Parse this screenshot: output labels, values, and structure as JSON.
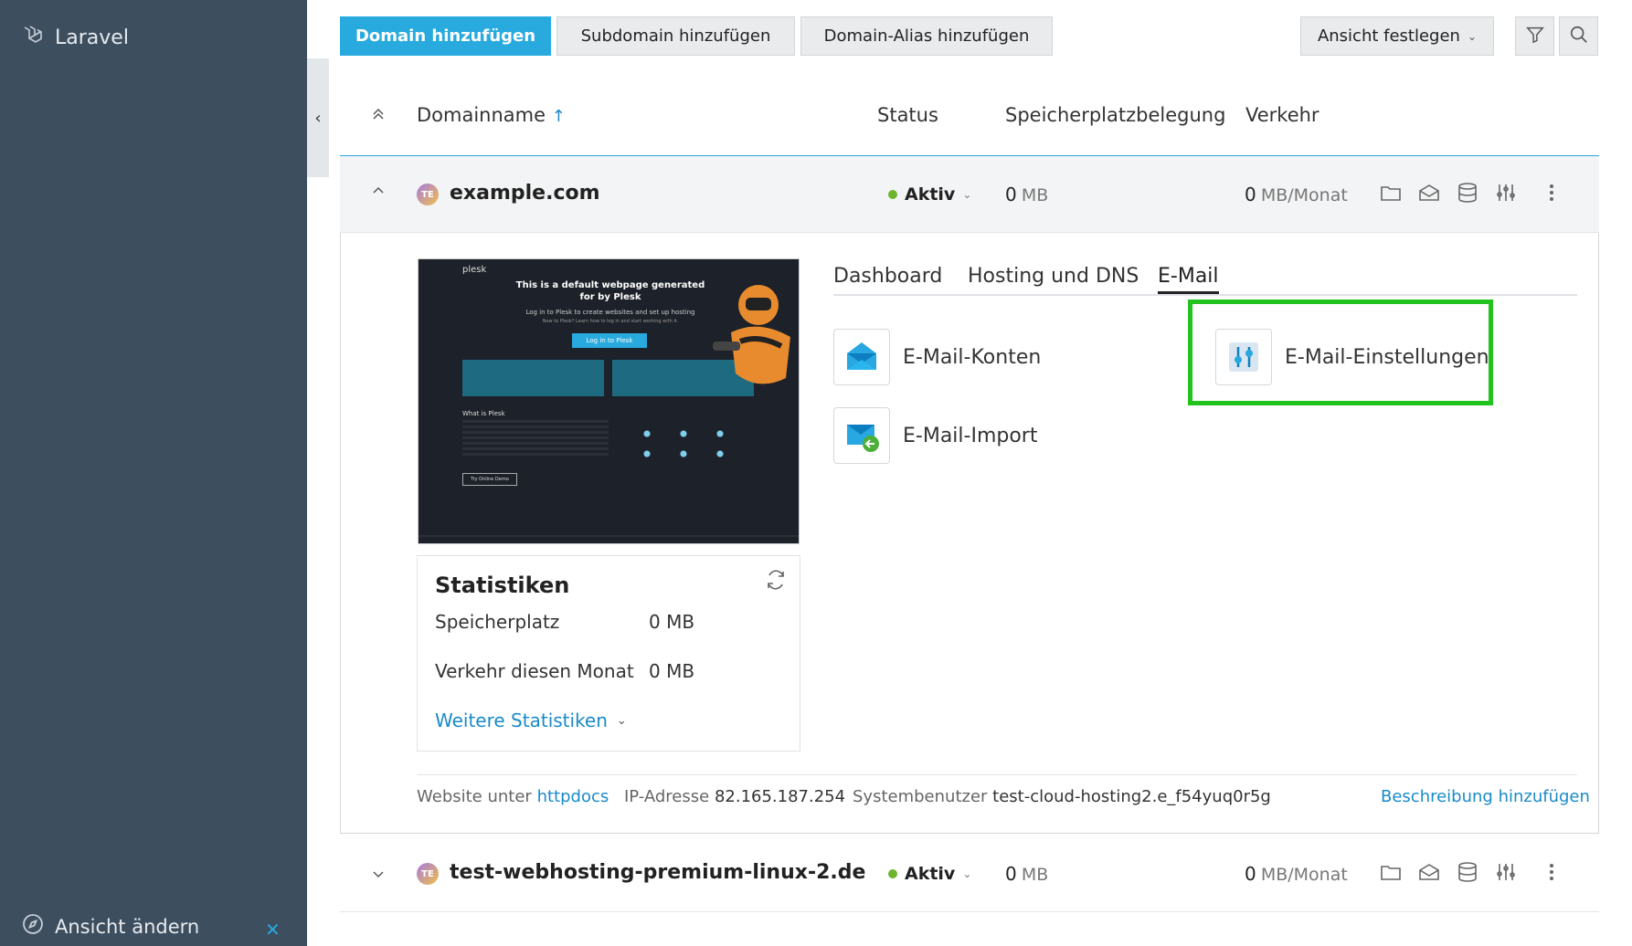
{
  "sidebar": {
    "brand": "Laravel",
    "bottom_label": "Ansicht ändern"
  },
  "toolbar": {
    "add_domain": "Domain hinzufügen",
    "add_subdomain": "Subdomain hinzufügen",
    "add_alias": "Domain-Alias hinzufügen",
    "view": "Ansicht festlegen"
  },
  "table": {
    "col_domain": "Domainname",
    "col_status": "Status",
    "col_storage": "Speicherplatzbelegung",
    "col_traffic": "Verkehr"
  },
  "domains": [
    {
      "avatar": "TE",
      "name": "example.com",
      "status": "Aktiv",
      "storage_value": "0",
      "storage_unit": "MB",
      "traffic_value": "0",
      "traffic_unit": "MB/Monat"
    },
    {
      "avatar": "TE",
      "name": "test-webhosting-premium-linux-2.de",
      "status": "Aktiv",
      "storage_value": "0",
      "storage_unit": "MB",
      "traffic_value": "0",
      "traffic_unit": "MB/Monat"
    }
  ],
  "preview": {
    "brand": "plesk",
    "heading": "This is a default webpage generated for by Plesk",
    "sub": "Log in to Plesk to create websites and set up hosting",
    "sub2": "New to Plesk? Learn how to log in and start working with it.",
    "button": "Log in to Plesk",
    "what_is": "What is Plesk",
    "demo_button": "Try Online Demo"
  },
  "stats": {
    "title": "Statistiken",
    "storage_label": "Speicherplatz",
    "storage_value": "0 MB",
    "traffic_label": "Verkehr diesen Monat",
    "traffic_value": "0 MB",
    "more_link": "Weitere Statistiken"
  },
  "tabs": [
    "Dashboard",
    "Hosting und DNS",
    "E-Mail"
  ],
  "email_tools": {
    "accounts": "E-Mail-Konten",
    "settings": "E-Mail-Einstellungen",
    "import": "E-Mail-Import"
  },
  "footer": {
    "website_label": "Website unter",
    "website_link": "httpdocs",
    "ip_label": "IP-Adresse",
    "ip_value": "82.165.187.254",
    "user_label": "Systembenutzer",
    "user_value": "test-cloud-hosting2.e_f54yuq0r5g",
    "add_description": "Beschreibung hinzufügen"
  },
  "colors": {
    "accent": "#28aade",
    "sidebar": "#3d4e5f",
    "status_active": "#6cb52d",
    "highlight": "#22c31f"
  }
}
